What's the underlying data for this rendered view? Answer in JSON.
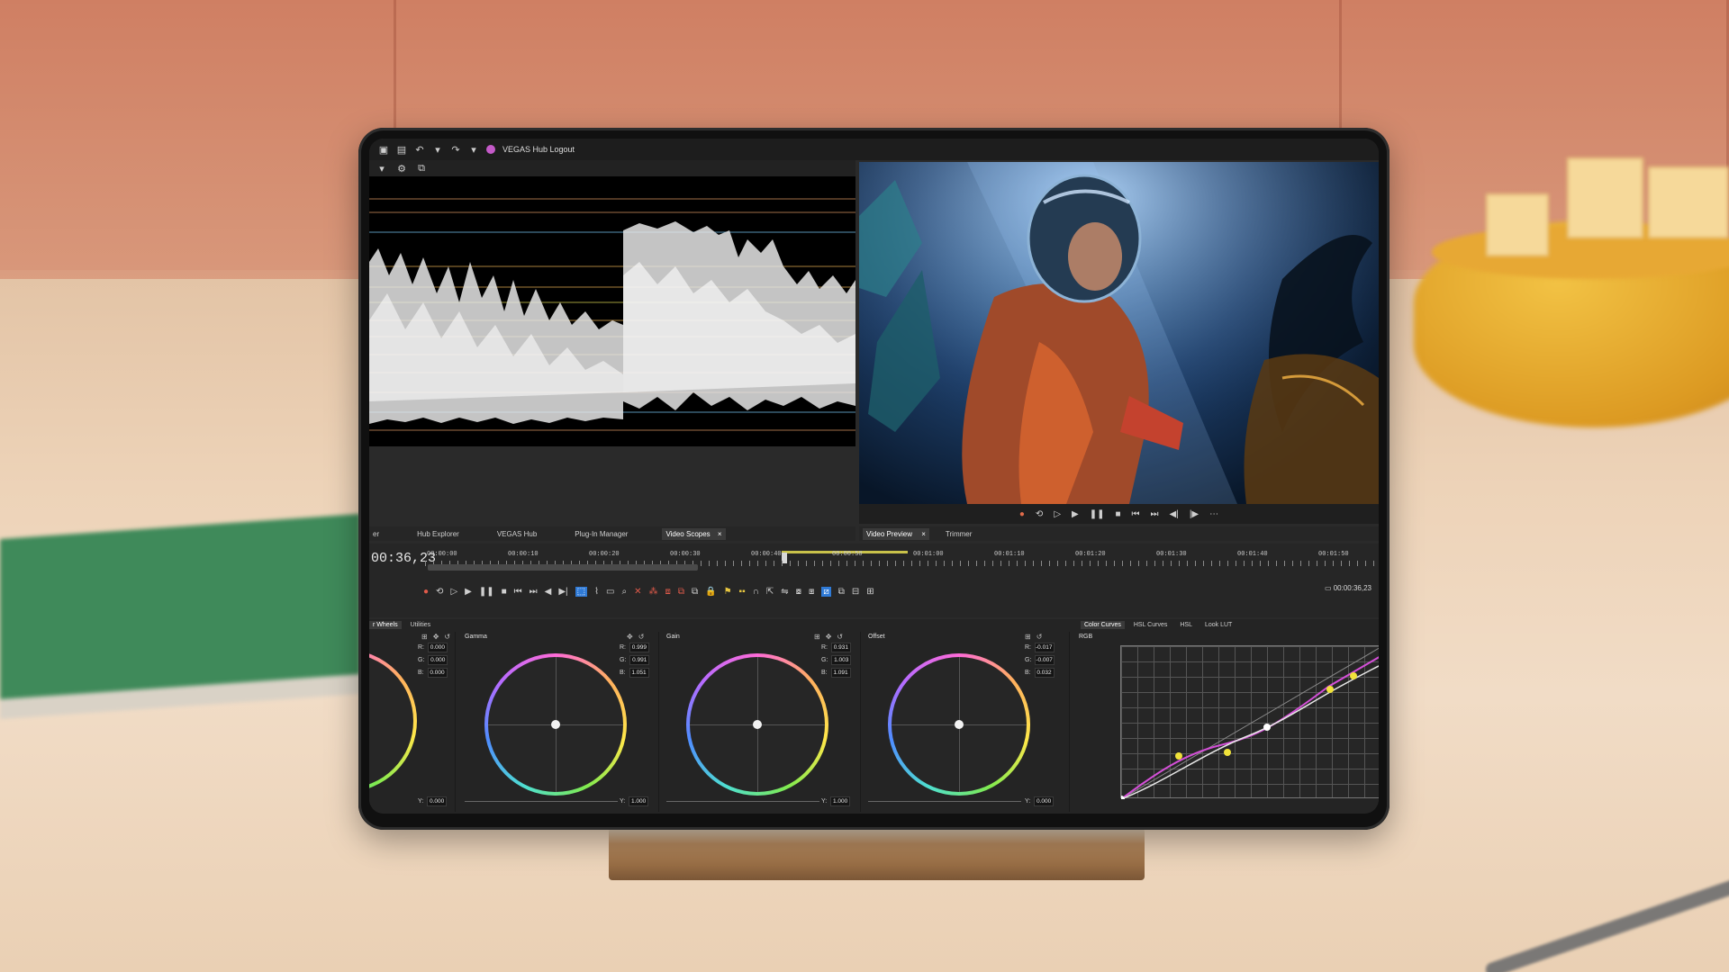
{
  "app": {
    "hub_label": "VEGAS Hub Logout"
  },
  "tabs_left": [
    {
      "label": "er",
      "active": false
    },
    {
      "label": "Hub Explorer",
      "active": false
    },
    {
      "label": "VEGAS Hub",
      "active": false
    },
    {
      "label": "Plug-In Manager",
      "active": false
    },
    {
      "label": "Video Scopes",
      "active": true
    }
  ],
  "tabs_right": [
    {
      "label": "Video Preview",
      "active": true
    },
    {
      "label": "Trimmer",
      "active": false
    }
  ],
  "close_glyph": "×",
  "timeline": {
    "timecode": "00:36,23",
    "timecode_right": "00:00:36,23",
    "ruler_labels": [
      "00:00:00",
      "00:00:10",
      "00:00:20",
      "00:00:30",
      "00:00:40",
      "00:00:50",
      "00:01:00",
      "00:01:10",
      "00:01:20",
      "00:01:30",
      "00:01:40",
      "00:01:50"
    ]
  },
  "grading": {
    "tabs": [
      "r Wheels",
      "Utilities"
    ],
    "curve_tabs": [
      "Color Curves",
      "HSL Curves",
      "HSL",
      "Look LUT"
    ],
    "curve_channel": "RGB",
    "panels": [
      {
        "title": "",
        "r": "0.000",
        "g": "0.000",
        "b": "0.000",
        "y": "0.000"
      },
      {
        "title": "Gamma",
        "r": "0.999",
        "g": "0.991",
        "b": "1.051",
        "y": "1.000"
      },
      {
        "title": "Gain",
        "r": "0.931",
        "g": "1.003",
        "b": "1.091",
        "y": "1.000"
      },
      {
        "title": "Offset",
        "r": "-0.017",
        "g": "-0.007",
        "b": "0.032",
        "y": "0.000"
      }
    ],
    "labels": {
      "r": "R:",
      "g": "G:",
      "b": "B:",
      "y": "Y:"
    }
  },
  "colors": {
    "accent": "#2f7ad6",
    "record": "#e06b4a",
    "curve": "#d44fd8",
    "curve_point": "#f0e23a"
  }
}
